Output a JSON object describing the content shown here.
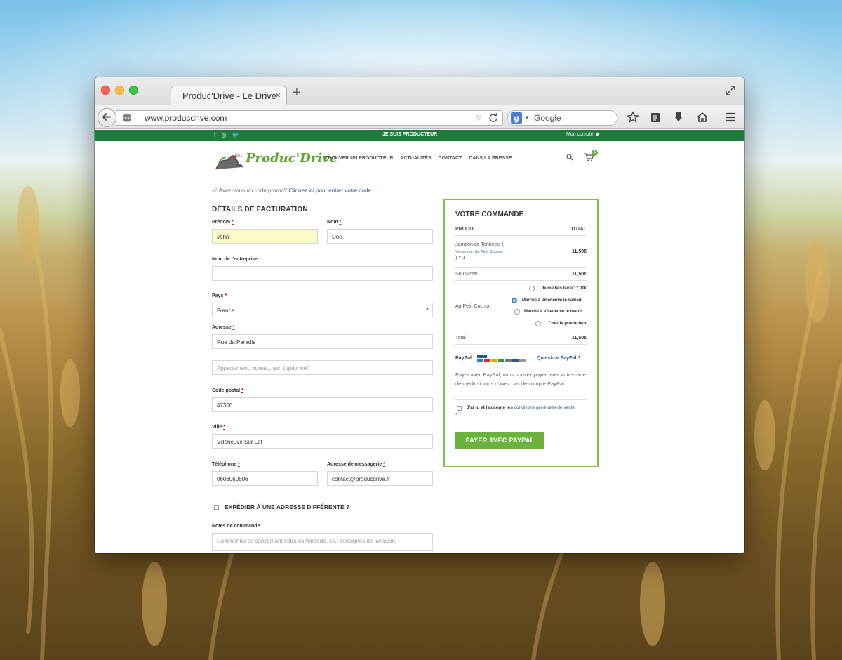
{
  "browser": {
    "tab_title": "Produc'Drive - Le Drive",
    "tab_close": "×",
    "new_tab": "+",
    "url": "www.producdrive.com",
    "search_engine_glyph": "g",
    "search_placeholder": "Google"
  },
  "site": {
    "topbar": {
      "social": "f ◎ 🐦",
      "producer_link": "JE SUIS PRODUCTEUR",
      "account_link": "Mon compte"
    },
    "logo": {
      "text": "Produc'Drive",
      "tagline": "1001"
    },
    "nav": [
      "TROUVER UN PRODUCTEUR",
      "ACTUALITÉS",
      "CONTACT",
      "DANS LA PRESSE"
    ],
    "cart_count": "1",
    "promo": {
      "text": "Avez-vous un code promo?",
      "link": "Cliquez ici pour entrer votre code"
    },
    "billing": {
      "title": "DÉTAILS DE FACTURATION",
      "first_name_label": "Prénom",
      "first_name_value": "John",
      "last_name_label": "Nom",
      "last_name_value": "Doe",
      "company_label": "Nom de l'entreprise",
      "company_value": "",
      "country_label": "Pays",
      "country_value": "France",
      "address_label": "Adresse",
      "address_value": "Rue du Paradis",
      "address2_placeholder": "Appartement, bureau, etc. (optionnel)",
      "postcode_label": "Code postal",
      "postcode_value": "47300",
      "city_label": "Ville",
      "city_value": "Villeneuve Sur Lot",
      "phone_label": "Téléphone",
      "phone_value": "0606060606",
      "email_label": "Adresse de messagerie",
      "email_value": "contact@producdrive.fr",
      "required_mark": "*",
      "ship_different": "EXPÉDIER À UNE ADRESSE DIFFÉRENTE ?",
      "notes_label": "Notes de commande",
      "notes_placeholder": "Commentaires concernant votre commande, ex.: consignes de livraison."
    },
    "order": {
      "title": "VOTRE COMMANDE",
      "col_product": "PRODUIT",
      "col_total": "TOTAL",
      "product_name": "Jambon de Tonneins (",
      "sold_by_prefix": "Vendu par:",
      "sold_by": "Au Petit Cochon",
      "product_qty": ") × 1",
      "product_total": "11,50€",
      "subtotal_label": "Sous-total",
      "subtotal_value": "11,50€",
      "shipping_vendor": "Au Petit Cochon",
      "shipping_options": [
        {
          "label": "Je me fais livrer: 7,00€",
          "selected": false
        },
        {
          "label": "Marché à Villeneuve le samedi",
          "selected": true
        },
        {
          "label": "Marché à Villeneuve le mardi",
          "selected": false
        },
        {
          "label": "Chez le producteur",
          "selected": false
        }
      ],
      "total_label": "Total",
      "total_value": "11,50€",
      "payment_method": "PayPal",
      "paypal_link": "Qu'est-ce PayPal ?",
      "paypal_desc": "Payer avec PayPal, vous pouvez payer avec votre carte de crédit si vous n'avez pas de compte PayPal.",
      "terms_text": "J'ai lu et j'accepte les",
      "terms_link": "conditions générales de vente",
      "terms_required": "*",
      "pay_button": "PAYER AVEC PAYPAL"
    }
  },
  "colors": {
    "brand_green": "#6cb33e",
    "topbar_green": "#1f7a3d",
    "link_blue": "#2c5a86"
  }
}
